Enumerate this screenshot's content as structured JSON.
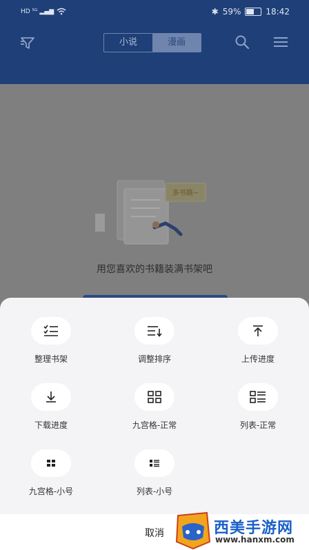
{
  "status_bar": {
    "left": "HD ⁵ᴳ ▂▄▆",
    "battery": "59%",
    "time": "18:42",
    "battery_level": 0.59
  },
  "header": {
    "tabs": [
      "小说",
      "漫画"
    ],
    "active_tab": 1
  },
  "empty_state": {
    "message": "用您喜欢的书籍装满书架吧",
    "illustration_text": "多书籍~"
  },
  "sheet": {
    "actions": [
      {
        "label": "整理书架",
        "icon": "checklist-icon"
      },
      {
        "label": "调整排序",
        "icon": "sort-icon"
      },
      {
        "label": "上传进度",
        "icon": "upload-icon"
      },
      {
        "label": "下载进度",
        "icon": "download-icon"
      },
      {
        "label": "九宫格-正常",
        "icon": "grid-icon"
      },
      {
        "label": "列表-正常",
        "icon": "list-icon"
      },
      {
        "label": "九宫格-小号",
        "icon": "grid-small-icon"
      },
      {
        "label": "列表-小号",
        "icon": "list-small-icon"
      }
    ],
    "cancel": "取消"
  },
  "watermark": {
    "title": "西美手游网",
    "url": "www.hanxm.com"
  }
}
